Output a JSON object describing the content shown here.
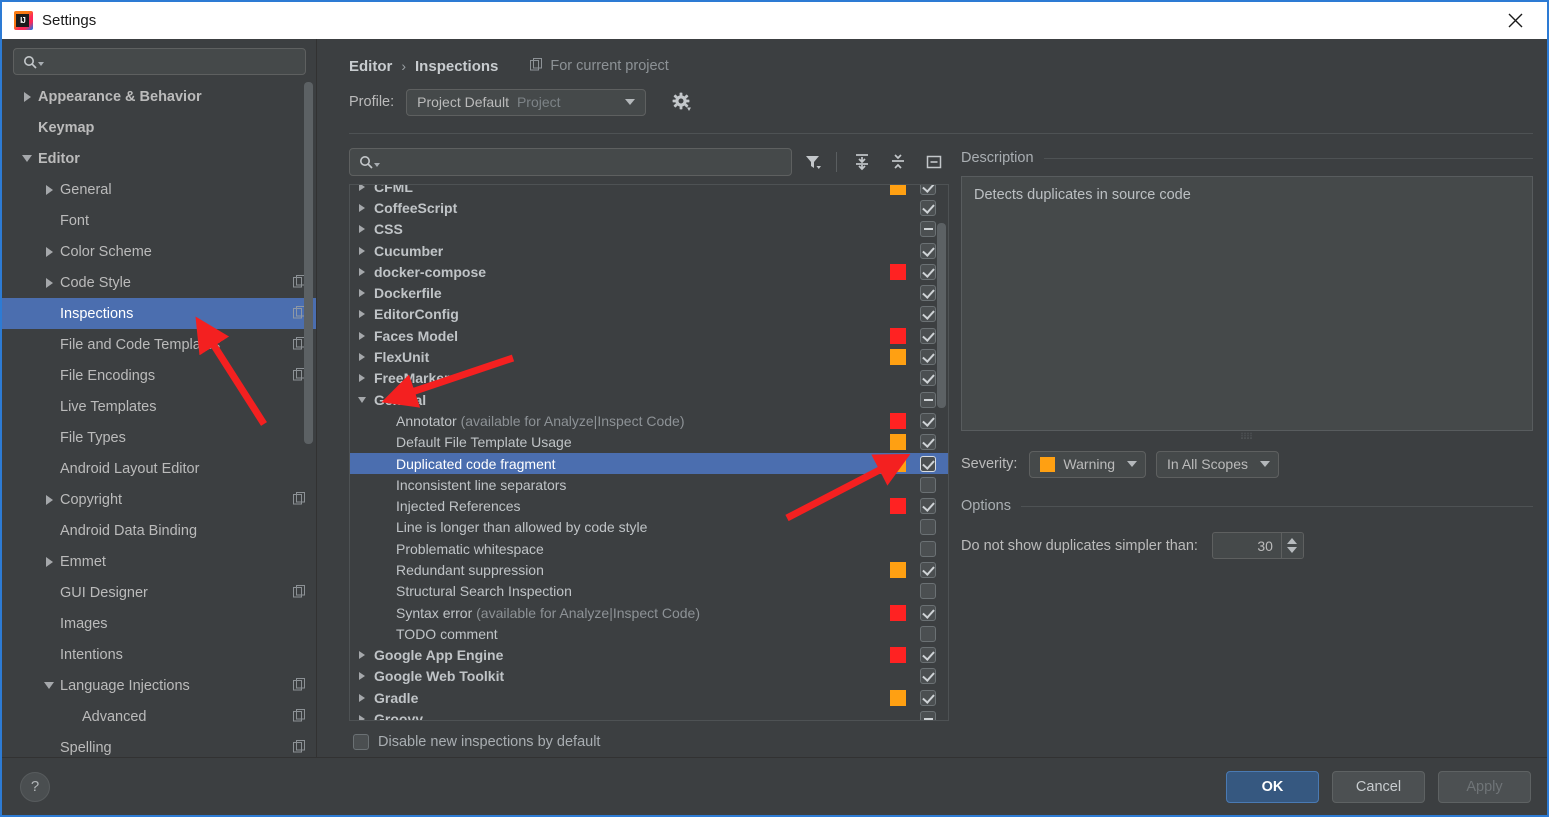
{
  "window": {
    "title": "Settings",
    "app_icon": "intellij-idea-icon",
    "close_icon": "close-icon"
  },
  "sidebar": {
    "search": {
      "placeholder": "",
      "value": "",
      "icon": "search-icon"
    },
    "items": [
      {
        "label": "Appearance & Behavior",
        "level": 0,
        "twisty": "right",
        "copy": false
      },
      {
        "label": "Keymap",
        "level": 0,
        "twisty": "none",
        "copy": false
      },
      {
        "label": "Editor",
        "level": 0,
        "twisty": "down",
        "copy": false
      },
      {
        "label": "General",
        "level": 1,
        "twisty": "right",
        "copy": false
      },
      {
        "label": "Font",
        "level": 1,
        "twisty": "none",
        "copy": false
      },
      {
        "label": "Color Scheme",
        "level": 1,
        "twisty": "right",
        "copy": false
      },
      {
        "label": "Code Style",
        "level": 1,
        "twisty": "right",
        "copy": true
      },
      {
        "label": "Inspections",
        "level": 1,
        "twisty": "none",
        "copy": true,
        "selected": true
      },
      {
        "label": "File and Code Templates",
        "level": 1,
        "twisty": "none",
        "copy": true
      },
      {
        "label": "File Encodings",
        "level": 1,
        "twisty": "none",
        "copy": true
      },
      {
        "label": "Live Templates",
        "level": 1,
        "twisty": "none",
        "copy": false
      },
      {
        "label": "File Types",
        "level": 1,
        "twisty": "none",
        "copy": false
      },
      {
        "label": "Android Layout Editor",
        "level": 1,
        "twisty": "none",
        "copy": false
      },
      {
        "label": "Copyright",
        "level": 1,
        "twisty": "right",
        "copy": true
      },
      {
        "label": "Android Data Binding",
        "level": 1,
        "twisty": "none",
        "copy": false
      },
      {
        "label": "Emmet",
        "level": 1,
        "twisty": "right",
        "copy": false
      },
      {
        "label": "GUI Designer",
        "level": 1,
        "twisty": "none",
        "copy": true
      },
      {
        "label": "Images",
        "level": 1,
        "twisty": "none",
        "copy": false
      },
      {
        "label": "Intentions",
        "level": 1,
        "twisty": "none",
        "copy": false
      },
      {
        "label": "Language Injections",
        "level": 1,
        "twisty": "down",
        "copy": true
      },
      {
        "label": "Advanced",
        "level": 2,
        "twisty": "none",
        "copy": true
      },
      {
        "label": "Spelling",
        "level": 1,
        "twisty": "none",
        "copy": true
      }
    ]
  },
  "breadcrumb": {
    "parent": "Editor",
    "separator": "›",
    "current": "Inspections",
    "scope_note": "For current project",
    "scope_icon": "copy-icon"
  },
  "profile": {
    "label": "Profile:",
    "value": "Project Default",
    "suffix": "Project",
    "gear_icon": "gear-icon"
  },
  "toolbar": {
    "search": {
      "placeholder": "",
      "value": "",
      "icon": "search-icon"
    },
    "filter_icon": "filter-funnel-icon",
    "expand_all_icon": "expand-all-icon",
    "collapse_all_icon": "collapse-all-icon",
    "reset_icon": "reset-box-icon"
  },
  "inspections": {
    "rows": [
      {
        "label": "CFML",
        "type": "group",
        "twisty": "right",
        "severity": "#ffa012",
        "check": "checked",
        "clipped": true
      },
      {
        "label": "CoffeeScript",
        "type": "group",
        "twisty": "right",
        "severity": null,
        "check": "checked"
      },
      {
        "label": "CSS",
        "type": "group",
        "twisty": "right",
        "severity": null,
        "check": "partial"
      },
      {
        "label": "Cucumber",
        "type": "group",
        "twisty": "right",
        "severity": null,
        "check": "checked"
      },
      {
        "label": "docker-compose",
        "type": "group",
        "twisty": "right",
        "severity": "#ff2222",
        "check": "checked"
      },
      {
        "label": "Dockerfile",
        "type": "group",
        "twisty": "right",
        "severity": null,
        "check": "checked"
      },
      {
        "label": "EditorConfig",
        "type": "group",
        "twisty": "right",
        "severity": null,
        "check": "checked"
      },
      {
        "label": "Faces Model",
        "type": "group",
        "twisty": "right",
        "severity": "#ff2222",
        "check": "checked"
      },
      {
        "label": "FlexUnit",
        "type": "group",
        "twisty": "right",
        "severity": "#ffa012",
        "check": "checked"
      },
      {
        "label": "FreeMarker",
        "type": "group",
        "twisty": "right",
        "severity": null,
        "check": "checked"
      },
      {
        "label": "General",
        "type": "group",
        "twisty": "down",
        "severity": null,
        "check": "partial"
      },
      {
        "label": "Annotator",
        "note": " (available for Analyze|Inspect Code)",
        "type": "child",
        "severity": "#ff2222",
        "check": "checked"
      },
      {
        "label": "Default File Template Usage",
        "type": "child",
        "severity": "#ffa012",
        "check": "checked"
      },
      {
        "label": "Duplicated code fragment",
        "type": "child",
        "severity": "#ffa012",
        "check": "checked",
        "selected": true
      },
      {
        "label": "Inconsistent line separators",
        "type": "child",
        "severity": null,
        "check": "none"
      },
      {
        "label": "Injected References",
        "type": "child",
        "severity": "#ff2222",
        "check": "checked"
      },
      {
        "label": "Line is longer than allowed by code style",
        "type": "child",
        "severity": null,
        "check": "none"
      },
      {
        "label": "Problematic whitespace",
        "type": "child",
        "severity": null,
        "check": "none"
      },
      {
        "label": "Redundant suppression",
        "type": "child",
        "severity": "#ffa012",
        "check": "checked"
      },
      {
        "label": "Structural Search Inspection",
        "type": "child",
        "severity": null,
        "check": "none"
      },
      {
        "label": "Syntax error",
        "note": " (available for Analyze|Inspect Code)",
        "type": "child",
        "severity": "#ff2222",
        "check": "checked"
      },
      {
        "label": "TODO comment",
        "type": "child",
        "severity": null,
        "check": "none"
      },
      {
        "label": "Google App Engine",
        "type": "group",
        "twisty": "right",
        "severity": "#ff2222",
        "check": "checked"
      },
      {
        "label": "Google Web Toolkit",
        "type": "group",
        "twisty": "right",
        "severity": null,
        "check": "checked"
      },
      {
        "label": "Gradle",
        "type": "group",
        "twisty": "right",
        "severity": "#ffa012",
        "check": "checked"
      },
      {
        "label": "Groovy",
        "type": "group",
        "twisty": "right",
        "severity": null,
        "check": "partial"
      }
    ],
    "disable_new": {
      "label": "Disable new inspections by default",
      "checked": false
    }
  },
  "detail": {
    "description_title": "Description",
    "description_text": "Detects duplicates in source code",
    "severity_label": "Severity:",
    "severity_value": "Warning",
    "severity_color": "#ffa012",
    "scope_value": "In All Scopes",
    "options_title": "Options",
    "option_label": "Do not show duplicates simpler than:",
    "option_value": "30"
  },
  "footer": {
    "help_label": "?",
    "ok": "OK",
    "cancel": "Cancel",
    "apply": "Apply"
  },
  "colors": {
    "accent_blue": "#4b6eaf",
    "window_border": "#2d7bd4",
    "severity_error": "#ff2222",
    "severity_warning": "#ffa012",
    "annotation_red": "#f42020"
  }
}
